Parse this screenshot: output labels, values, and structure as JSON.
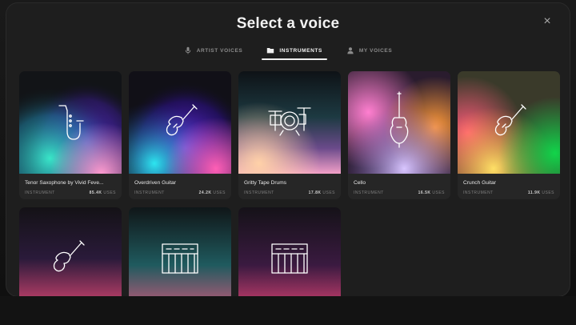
{
  "modal": {
    "title": "Select a voice",
    "close_label": "×"
  },
  "tabs": [
    {
      "label": "ARTIST VOICES",
      "icon": "microphone-icon",
      "active": false
    },
    {
      "label": "INSTRUMENTS",
      "icon": "folder-icon",
      "active": true
    },
    {
      "label": "MY VOICES",
      "icon": "user-icon",
      "active": false
    }
  ],
  "cards": [
    {
      "name": "Tenor Saxophone by Vivid Feve...",
      "category": "INSTRUMENT",
      "uses": "85.4K",
      "uses_suffix": "USES",
      "icon": "saxophone-icon"
    },
    {
      "name": "Overdriven Guitar",
      "category": "INSTRUMENT",
      "uses": "24.2K",
      "uses_suffix": "USES",
      "icon": "electric-guitar-icon"
    },
    {
      "name": "Gritty Tape Drums",
      "category": "INSTRUMENT",
      "uses": "17.8K",
      "uses_suffix": "USES",
      "icon": "drum-kit-icon"
    },
    {
      "name": "Cello",
      "category": "INSTRUMENT",
      "uses": "16.5K",
      "uses_suffix": "USES",
      "icon": "cello-icon"
    },
    {
      "name": "Crunch Guitar",
      "category": "INSTRUMENT",
      "uses": "11.9K",
      "uses_suffix": "USES",
      "icon": "electric-guitar-icon"
    },
    {
      "name": "",
      "category": "",
      "uses": "",
      "uses_suffix": "",
      "icon": "electric-guitar-icon"
    },
    {
      "name": "",
      "category": "",
      "uses": "",
      "uses_suffix": "",
      "icon": "synthesizer-icon"
    },
    {
      "name": "",
      "category": "",
      "uses": "",
      "uses_suffix": "",
      "icon": "synthesizer-icon"
    }
  ],
  "colors": {
    "background": "#1e1e1e",
    "card": "#262626",
    "text": "#e8e8e8",
    "muted": "#7f7f7f"
  }
}
